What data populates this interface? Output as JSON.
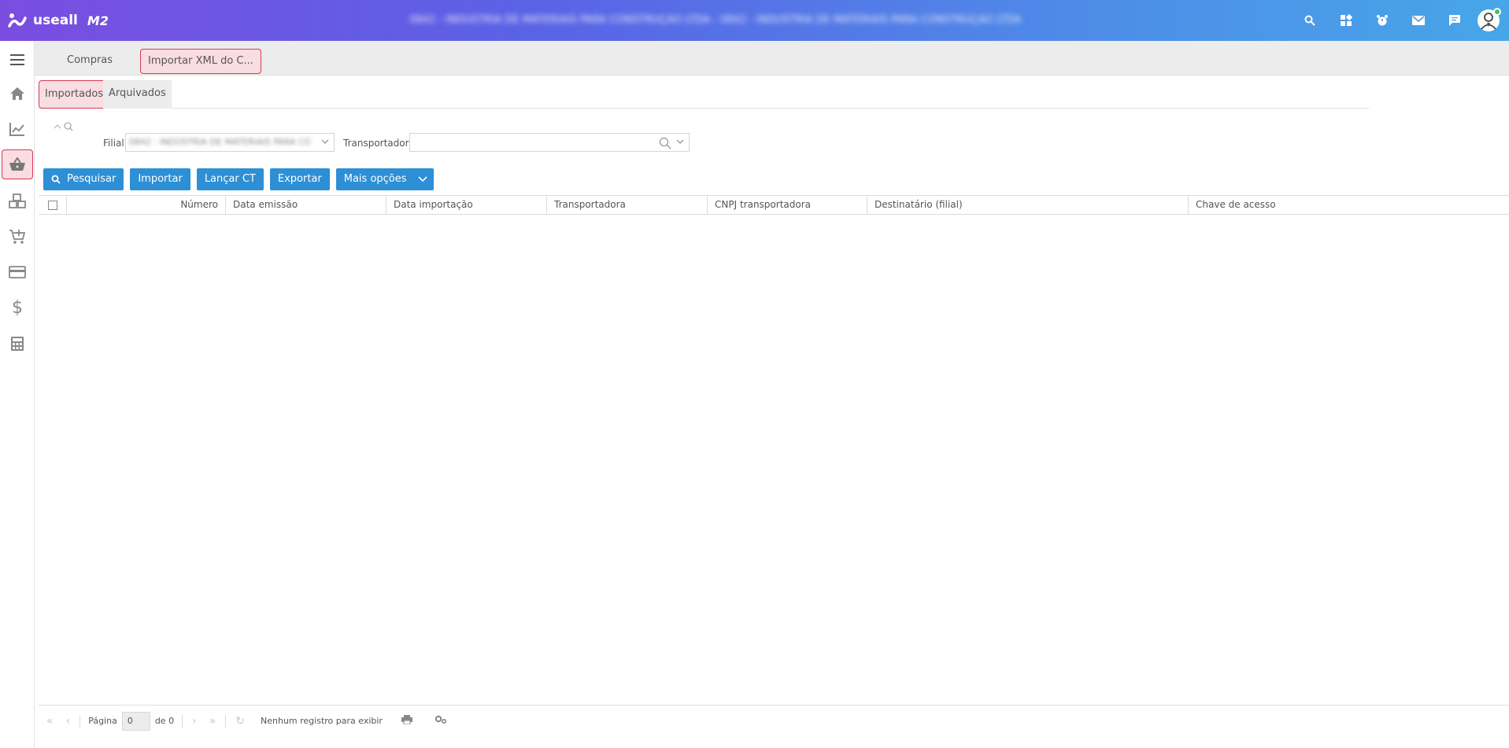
{
  "app": {
    "logo_text": "useall",
    "logo_version": "M2",
    "company_name": "0842 - INDÚSTRIA DE MATERIAIS PARA CONSTRUÇÃO LTDA - 0842 - INDÚSTRIA DE MATERIAIS PARA CONSTRUÇÃO LTDA"
  },
  "topbar_icons": [
    "search-icon",
    "apps-icon",
    "alarm-icon",
    "mail-icon",
    "chat-icon"
  ],
  "sidebar": {
    "items": [
      "menu-icon",
      "home-icon",
      "chart-icon",
      "basket-icon",
      "boxes-icon",
      "cart-add-icon",
      "card-icon",
      "dollar-icon",
      "calculator-icon"
    ],
    "active_index": 3
  },
  "tabs": {
    "compras": "Compras",
    "importar": "Importar XML do C..."
  },
  "subtabs": {
    "importados": "Importados",
    "arquivados": "Arquivados"
  },
  "filters": {
    "filial_label": "Filial",
    "filial_value": "0842 - INDÚSTRIA DE MATERIAIS PARA CO",
    "transportadora_label": "Transportadora",
    "transportadora_value": ""
  },
  "toolbar": {
    "pesquisar": "Pesquisar",
    "importar": "Importar",
    "lancar_ct": "Lançar CT",
    "exportar": "Exportar",
    "mais_opcoes": "Mais opções"
  },
  "grid": {
    "columns": [
      "Número",
      "Data emissão",
      "Data importação",
      "Transportadora",
      "CNPJ transportadora",
      "Destinatário (filial)",
      "Chave de acesso"
    ]
  },
  "pager": {
    "pagina_label": "Página",
    "page_value": "0",
    "de_label": "de 0",
    "status": "Nenhum registro para exibir"
  },
  "colors": {
    "accent_blue": "#2d8fd5",
    "active_border": "#d83a53",
    "active_bg": "#f9dde2"
  }
}
